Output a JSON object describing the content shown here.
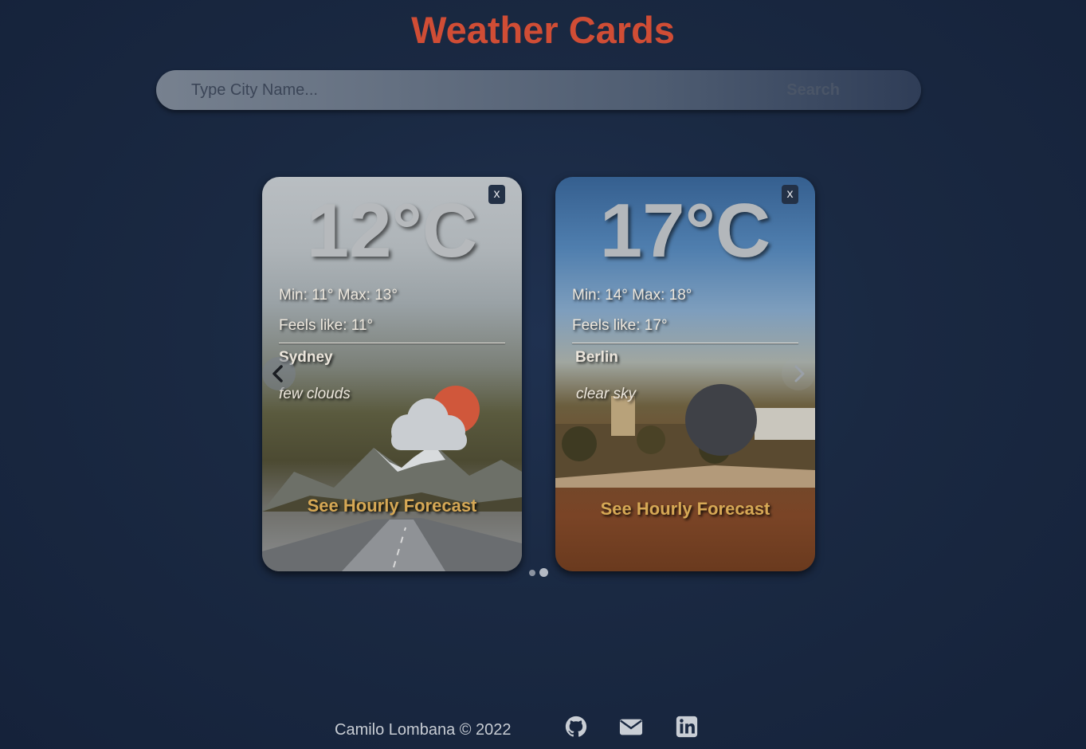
{
  "header": {
    "title": "Weather Cards"
  },
  "search": {
    "placeholder": "Type City Name...",
    "button_label": "Search"
  },
  "cards": [
    {
      "city": "Sydney",
      "temperature": "12°C",
      "min_max": "Min: 11° Max: 13°",
      "feels_like": "Feels like: 11°",
      "description": "few clouds",
      "icon": "few-clouds-icon",
      "close_label": "x",
      "forecast_label": "See Hourly Forecast"
    },
    {
      "city": "Berlin",
      "temperature": "17°C",
      "min_max": "Min: 14° Max: 18°",
      "feels_like": "Feels like: 17°",
      "description": "clear sky",
      "icon": "clear-sky-icon",
      "close_label": "x",
      "forecast_label": "See Hourly Forecast"
    }
  ],
  "carousel": {
    "prev_icon": "chevron-left-icon",
    "next_icon": "chevron-right-icon",
    "dot_count": 2,
    "active_dot": 2
  },
  "footer": {
    "copyright": "Camilo Lombana © 2022",
    "links": [
      "github-icon",
      "mail-icon",
      "linkedin-icon"
    ]
  },
  "colors": {
    "title": "#d04d35",
    "forecast_link": "#d6a855",
    "sun": "#d0573b",
    "background": "#1a2942"
  }
}
